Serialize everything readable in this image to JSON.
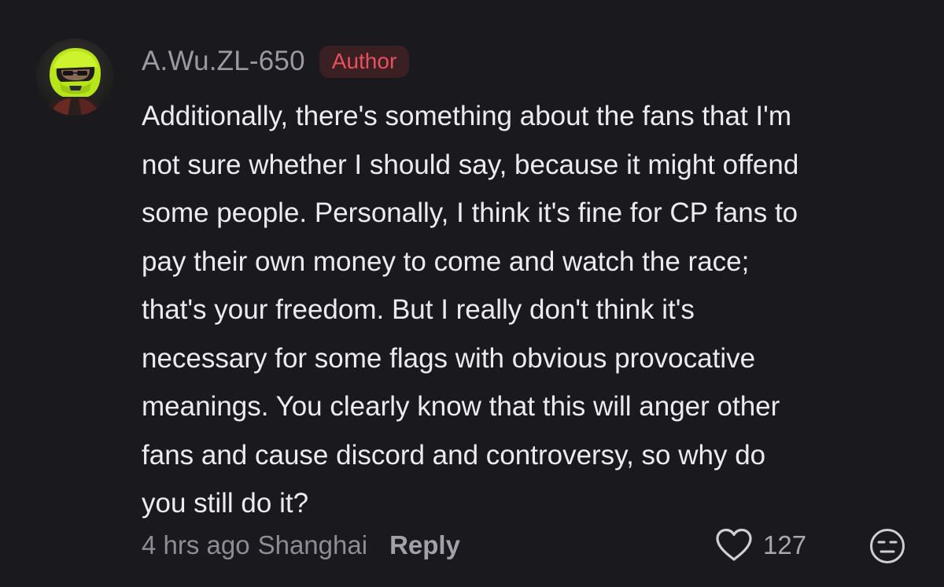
{
  "comment": {
    "username": "A.Wu.ZL-650",
    "badge": "Author",
    "text": "Additionally, there's something about the fans that I'm\nnot sure whether I should say, because it might offend\nsome people. Personally, I think it's fine for CP fans to\npay their own money to come and watch the race;\nthat's your freedom. But I really don't think it's\nnecessary for some flags with obvious provocative\nmeanings. You clearly know that this will anger other\nfans and cause discord and controversy, so why do\nyou still do it?",
    "timestamp": "4 hrs ago",
    "location": "Shanghai",
    "reply_label": "Reply",
    "like_count": "127"
  },
  "icons": {
    "avatar": "helmet-avatar",
    "like": "heart-icon",
    "emoji": "neutral-face-icon"
  },
  "colors": {
    "background": "#1a191e",
    "badge_text": "#e8505d",
    "badge_bg": "#3a1f23",
    "helmet": "#b8e51a"
  }
}
